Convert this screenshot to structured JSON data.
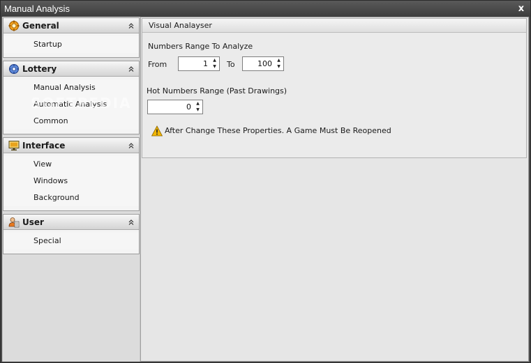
{
  "window": {
    "title": "Manual Analysis",
    "close_label": "x"
  },
  "sidebar": {
    "groups": [
      {
        "title": "General",
        "icon": "gear-icon",
        "items": [
          "Startup"
        ]
      },
      {
        "title": "Lottery",
        "icon": "lottery-icon",
        "items": [
          "Manual Analysis",
          "Automatic Analysis",
          "Common"
        ]
      },
      {
        "title": "Interface",
        "icon": "monitor-icon",
        "items": [
          "View",
          "Windows",
          "Background"
        ]
      },
      {
        "title": "User",
        "icon": "user-icon",
        "items": [
          "Special"
        ]
      }
    ],
    "collapse_glyph": "⌃"
  },
  "panel": {
    "title": "Visual Analayser",
    "numbers_range_label": "Numbers Range To Analyze",
    "from_label": "From",
    "from_value": "1",
    "to_label": "To",
    "to_value": "100",
    "hot_range_label": "Hot Numbers Range (Past Drawings)",
    "hot_value": "0",
    "warning_text": "After Change These Properties. A Game Must Be Reopened"
  },
  "watermark": "SOFTPEDIA",
  "colors": {
    "title_bar": "#4a4a4a",
    "warning": "#f2b705",
    "accent_orange": "#e38b17"
  }
}
